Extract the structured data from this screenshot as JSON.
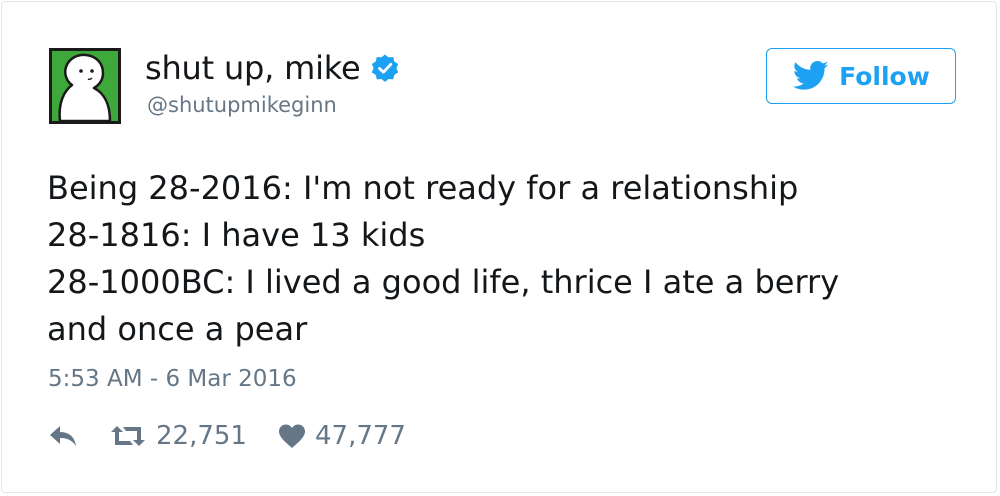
{
  "tweet": {
    "author": {
      "display_name": "shut up, mike",
      "handle": "@shutupmikeginn",
      "verified": true,
      "avatar_color": "#3ea83a"
    },
    "follow_button": {
      "label": "Follow",
      "icon": "twitter-bird-icon",
      "color": "#1da1f2"
    },
    "text_lines": [
      "Being 28-2016: I'm not ready for a relationship",
      "28-1816: I have 13 kids",
      "28-1000BC: I lived a good life, thrice I ate a berry",
      "and once a pear"
    ],
    "timestamp": "5:53 AM - 6 Mar 2016",
    "actions": {
      "reply_icon": "reply-icon",
      "retweet_icon": "retweet-icon",
      "retweet_count": "22,751",
      "like_icon": "heart-icon",
      "like_count": "47,777"
    }
  }
}
